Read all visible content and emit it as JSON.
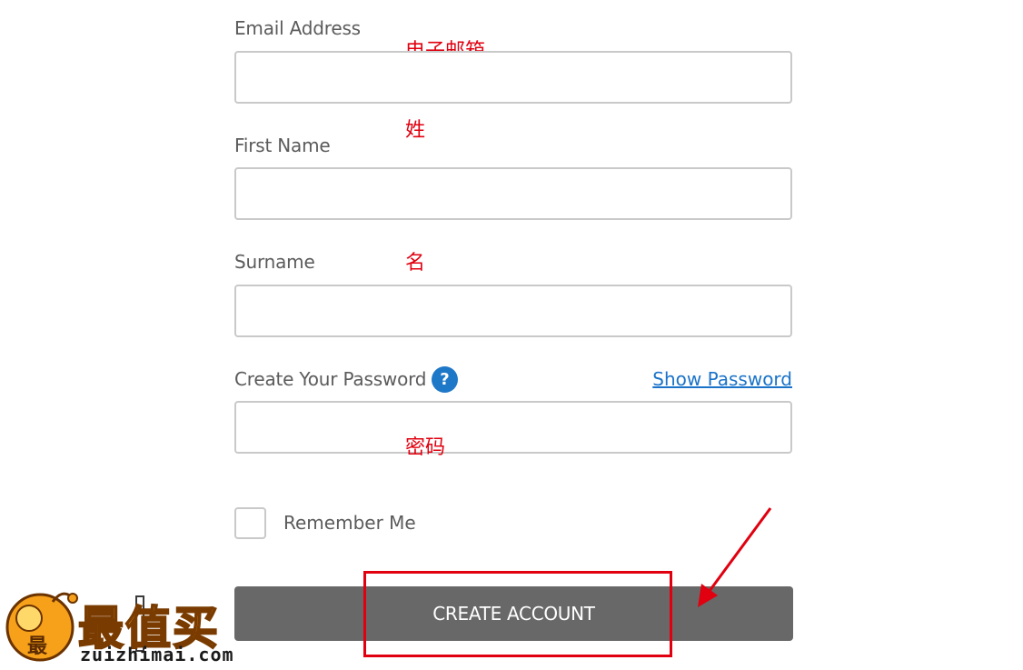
{
  "form": {
    "email_label": "Email Address",
    "first_name_label": "First Name",
    "surname_label": "Surname",
    "password_label": "Create Your Password",
    "help_icon_glyph": "?",
    "show_password_label": "Show Password",
    "remember_label": "Remember Me",
    "create_button_label": "CREATE ACCOUNT"
  },
  "annotations": {
    "email": "电子邮箱",
    "first_name": "姓",
    "surname": "名",
    "password": "密码"
  },
  "watermark": {
    "logo_text": "最值买",
    "url": "zuizhimai.com",
    "mascot_text": "最"
  },
  "colors": {
    "annotation": "#e0000f",
    "button": "#686868",
    "link": "#1a73c9",
    "help_icon": "#1e78c8"
  }
}
